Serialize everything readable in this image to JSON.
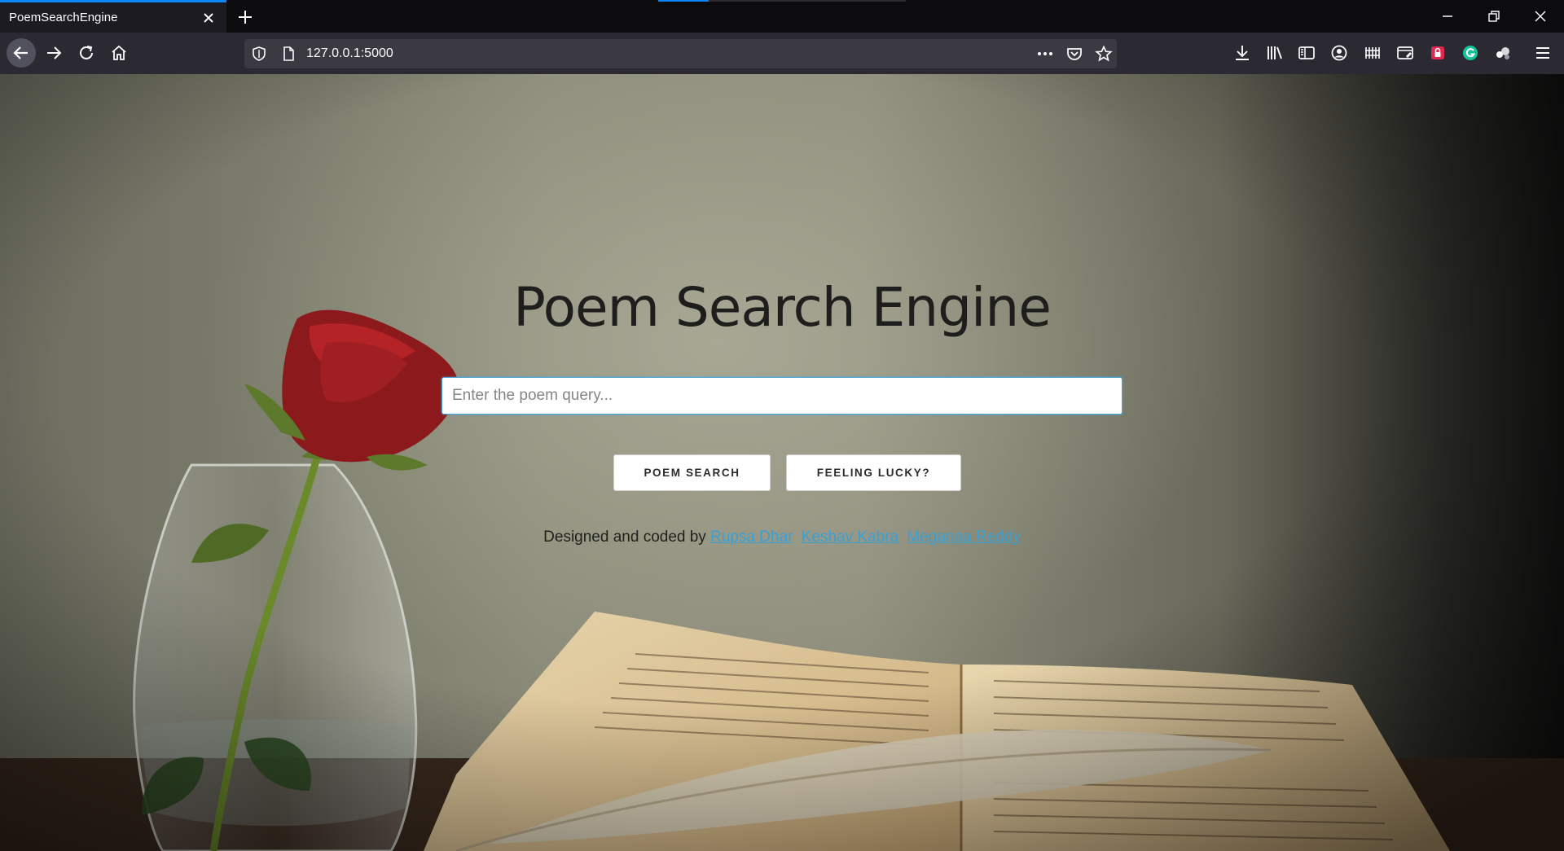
{
  "browser": {
    "tab_title": "PoemSearchEngine",
    "url": "127.0.0.1:5000",
    "icons": [
      "close-icon",
      "plus-icon",
      "minimize-icon",
      "restore-icon",
      "back-arrow-icon",
      "forward-arrow-icon",
      "reload-icon",
      "home-icon",
      "shield-icon",
      "page-icon",
      "more-icon",
      "pocket-icon",
      "star-icon",
      "download-icon",
      "library-icon",
      "sidebar-icon",
      "account-icon",
      "grid-extension-icon",
      "screenshot-icon",
      "lock-extension-icon",
      "grammarly-icon",
      "extension-icon",
      "menu-icon"
    ],
    "accent": "#0a84ff"
  },
  "page": {
    "title": "Poem Search Engine",
    "search_placeholder": "Enter the poem query...",
    "search_button": "Poem Search",
    "lucky_button": "Feeling Lucky?",
    "credits_prefix": "Designed and coded by",
    "authors": [
      "Rupsa Dhar",
      "Keshav Kabra",
      "Meganaa Reddy"
    ],
    "link_color": "#3aa0d2"
  }
}
